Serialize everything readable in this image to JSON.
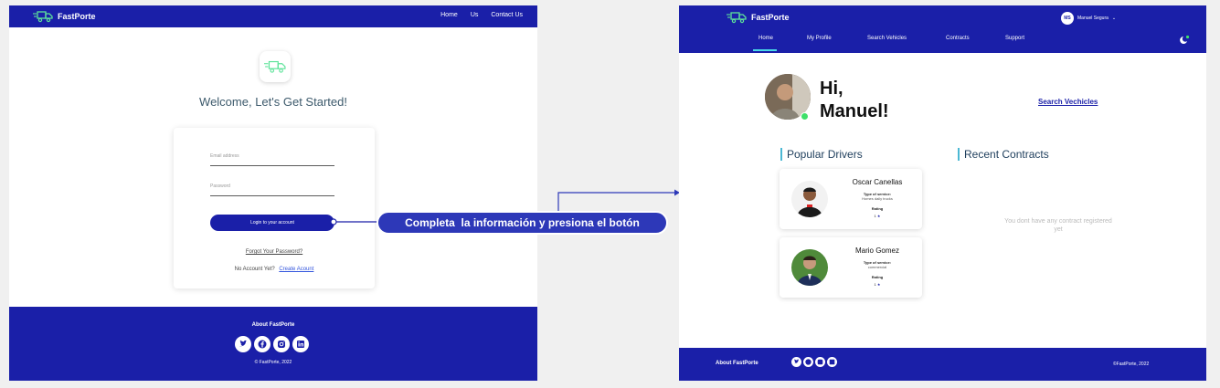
{
  "left": {
    "brand": "FastPorte",
    "nav": [
      "Home",
      "Us",
      "Contact Us"
    ],
    "welcome": "Welcome, Let's Get Started!",
    "email_placeholder": "Email address",
    "password_placeholder": "Password",
    "login_button": "Login to your account",
    "forgot_password": "Forgot Your Password?",
    "no_account": "No Account Yet?",
    "create_account": "Create Acount",
    "footer_title": "About FastPorte",
    "copyright": "© FastPorte, 2022",
    "social_icons": [
      "twitter-icon",
      "facebook-icon",
      "instagram-icon",
      "linkedin-icon"
    ]
  },
  "callout": {
    "text": "Completa  la información y presiona el botón"
  },
  "right": {
    "brand": "FastPorte",
    "user_initials": "MS",
    "user_name": "Manuel Segura",
    "nav": [
      "Home",
      "My Profile",
      "Search Vehicles",
      "Contracts",
      "Support"
    ],
    "greeting": "Hi,\nManuel!",
    "search_link": "Search Vechicles",
    "popular_drivers": "Popular Drivers",
    "recent_contracts": "Recent Contracts",
    "drivers": [
      {
        "name": "Oscar Canellas",
        "type_label": "Type of service:",
        "type": "Homes daily trucks",
        "rating_label": "Rating",
        "rating": "1"
      },
      {
        "name": "Mario Gomez",
        "type_label": "Type of service:",
        "type": "commercial",
        "rating_label": "Rating",
        "rating": "1"
      }
    ],
    "no_contracts": "You dont have any contract registered yet",
    "footer_title": "About FastPorte",
    "copyright": "©FastPorte, 2022"
  },
  "colors": {
    "brand_blue": "#1a1fa8",
    "accent_teal": "#4bb8d4",
    "online_green": "#3ee06a",
    "callout_fill": "#2d38b8"
  }
}
